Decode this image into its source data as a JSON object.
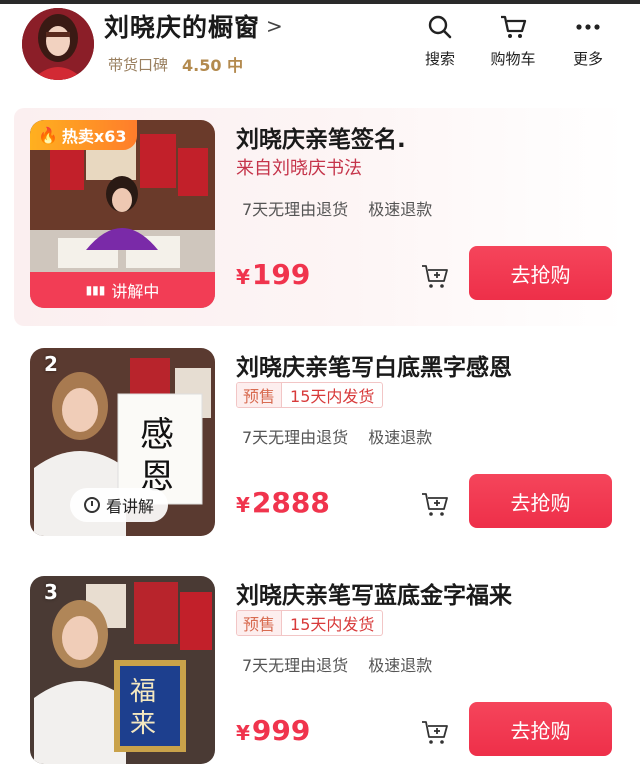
{
  "header": {
    "shop_title": "刘晓庆的橱窗",
    "rating_label": "带货口碑",
    "rating_score": "4.50 中",
    "actions": [
      {
        "label": "搜索",
        "icon": "search-icon"
      },
      {
        "label": "购物车",
        "icon": "cart-icon"
      },
      {
        "label": "更多",
        "icon": "more-icon"
      }
    ]
  },
  "products": [
    {
      "badge": "热卖x63",
      "title": "刘晓庆亲笔签名.",
      "subtitle": "来自刘晓庆书法",
      "services": [
        "7天无理由退货",
        "极速退款"
      ],
      "currency": "¥",
      "price": "199",
      "buy_label": "去抢购",
      "live_label": "讲解中"
    },
    {
      "rank": "2",
      "title": "刘晓庆亲笔写白底黑字感恩",
      "tag_a": "预售",
      "tag_b": "15天内发货",
      "services": [
        "7天无理由退货",
        "极速退款"
      ],
      "currency": "¥",
      "price": "2888",
      "buy_label": "去抢购",
      "replay_label": "看讲解"
    },
    {
      "rank": "3",
      "title": "刘晓庆亲笔写蓝底金字福来",
      "tag_a": "预售",
      "tag_b": "15天内发货",
      "services": [
        "7天无理由退货",
        "极速退款"
      ],
      "currency": "¥",
      "price": "999",
      "buy_label": "去抢购"
    }
  ],
  "colors": {
    "accent": "#f0344d",
    "badge": "#ff9a24",
    "gold": "#b38a4e"
  }
}
